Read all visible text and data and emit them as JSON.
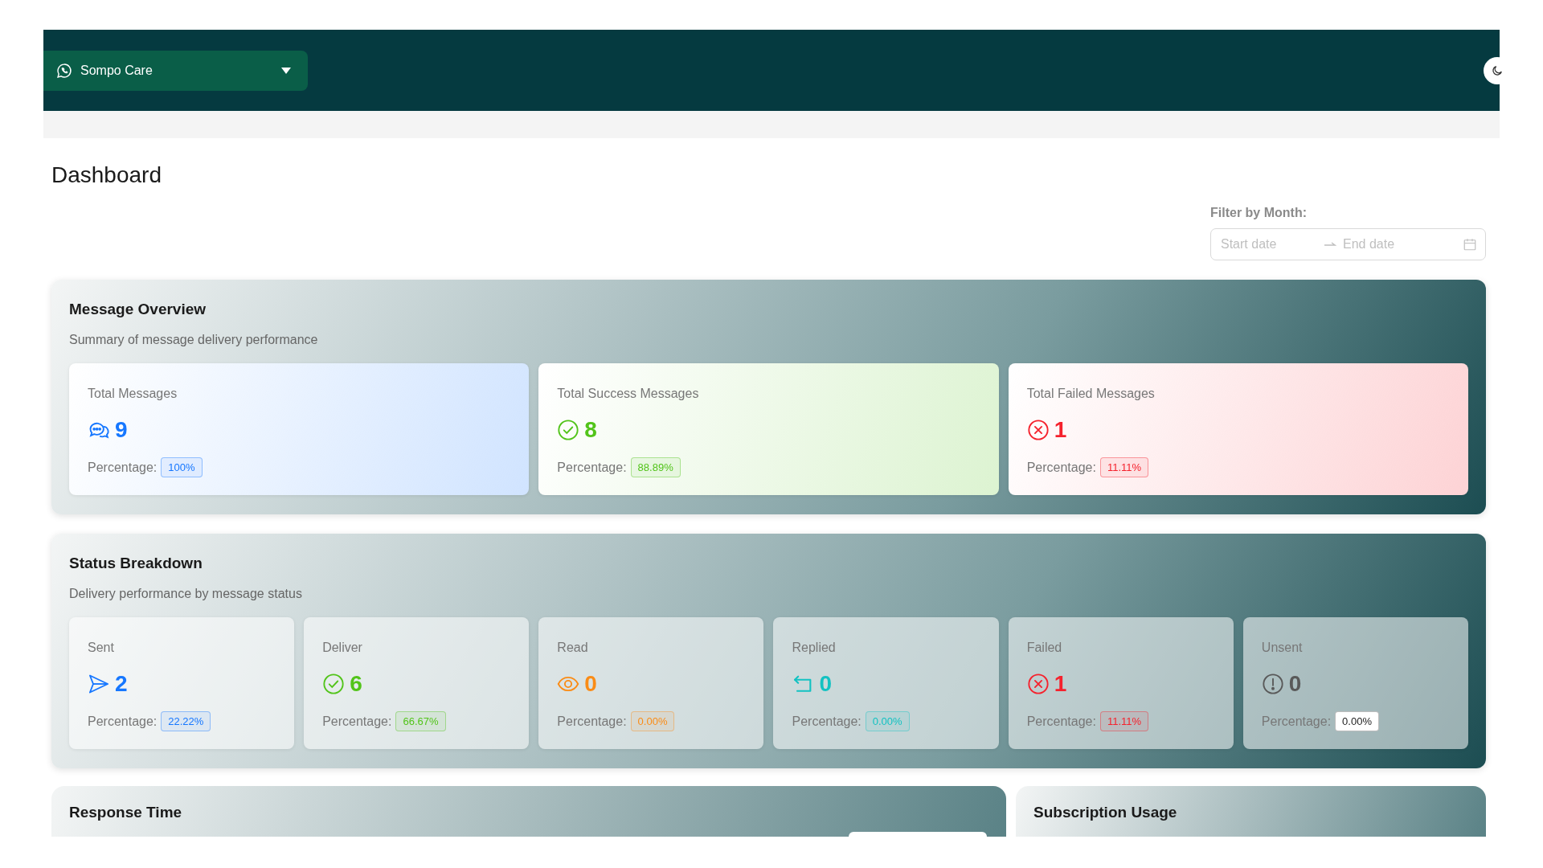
{
  "header": {
    "workspace": "Sompo Care"
  },
  "page": {
    "title": "Dashboard"
  },
  "filter": {
    "label": "Filter by Month:",
    "start_placeholder": "Start date",
    "end_placeholder": "End date"
  },
  "overview": {
    "title": "Message Overview",
    "subtitle": "Summary of message delivery performance",
    "cards": [
      {
        "label": "Total Messages",
        "kind": "chat",
        "color": "#1677ff",
        "value": "9",
        "percentage_label": "Percentage:",
        "percentage": "100%"
      },
      {
        "label": "Total Success Messages",
        "kind": "check",
        "color": "#52c41a",
        "value": "8",
        "percentage_label": "Percentage:",
        "percentage": "88.89%"
      },
      {
        "label": "Total Failed Messages",
        "kind": "cross",
        "color": "#f5222d",
        "value": "1",
        "percentage_label": "Percentage:",
        "percentage": "11.11%"
      }
    ]
  },
  "status": {
    "title": "Status Breakdown",
    "subtitle": "Delivery performance by message status",
    "cards": [
      {
        "label": "Sent",
        "kind": "send",
        "color": "#1677ff",
        "value": "2",
        "percentage_label": "Percentage:",
        "percentage": "22.22%"
      },
      {
        "label": "Deliver",
        "kind": "check",
        "color": "#52c41a",
        "value": "6",
        "percentage_label": "Percentage:",
        "percentage": "66.67%"
      },
      {
        "label": "Read",
        "kind": "eye",
        "color": "#fa8c16",
        "value": "0",
        "percentage_label": "Percentage:",
        "percentage": "0.00%"
      },
      {
        "label": "Replied",
        "kind": "reply",
        "color": "#13c2c2",
        "value": "0",
        "percentage_label": "Percentage:",
        "percentage": "0.00%"
      },
      {
        "label": "Failed",
        "kind": "cross",
        "color": "#f5222d",
        "value": "1",
        "percentage_label": "Percentage:",
        "percentage": "11.11%"
      },
      {
        "label": "Unsent",
        "kind": "alert",
        "color": "#595959",
        "value": "0",
        "percentage_label": "Percentage:",
        "percentage": "0.00%"
      }
    ]
  },
  "bottom": [
    {
      "title": "Response Time"
    },
    {
      "title": "Subscription Usage"
    }
  ]
}
